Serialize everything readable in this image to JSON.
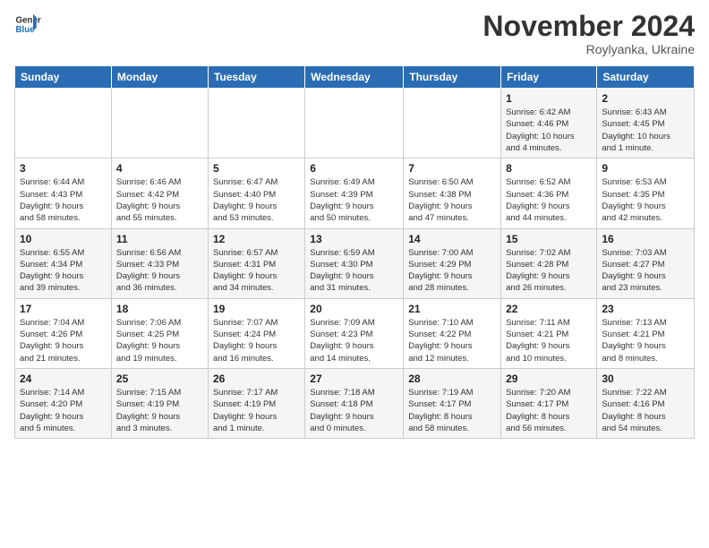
{
  "header": {
    "logo_line1": "General",
    "logo_line2": "Blue",
    "month_title": "November 2024",
    "subtitle": "Roylyanka, Ukraine"
  },
  "weekdays": [
    "Sunday",
    "Monday",
    "Tuesday",
    "Wednesday",
    "Thursday",
    "Friday",
    "Saturday"
  ],
  "weeks": [
    [
      {
        "day": "",
        "info": ""
      },
      {
        "day": "",
        "info": ""
      },
      {
        "day": "",
        "info": ""
      },
      {
        "day": "",
        "info": ""
      },
      {
        "day": "",
        "info": ""
      },
      {
        "day": "1",
        "info": "Sunrise: 6:42 AM\nSunset: 4:46 PM\nDaylight: 10 hours\nand 4 minutes."
      },
      {
        "day": "2",
        "info": "Sunrise: 6:43 AM\nSunset: 4:45 PM\nDaylight: 10 hours\nand 1 minute."
      }
    ],
    [
      {
        "day": "3",
        "info": "Sunrise: 6:44 AM\nSunset: 4:43 PM\nDaylight: 9 hours\nand 58 minutes."
      },
      {
        "day": "4",
        "info": "Sunrise: 6:46 AM\nSunset: 4:42 PM\nDaylight: 9 hours\nand 55 minutes."
      },
      {
        "day": "5",
        "info": "Sunrise: 6:47 AM\nSunset: 4:40 PM\nDaylight: 9 hours\nand 53 minutes."
      },
      {
        "day": "6",
        "info": "Sunrise: 6:49 AM\nSunset: 4:39 PM\nDaylight: 9 hours\nand 50 minutes."
      },
      {
        "day": "7",
        "info": "Sunrise: 6:50 AM\nSunset: 4:38 PM\nDaylight: 9 hours\nand 47 minutes."
      },
      {
        "day": "8",
        "info": "Sunrise: 6:52 AM\nSunset: 4:36 PM\nDaylight: 9 hours\nand 44 minutes."
      },
      {
        "day": "9",
        "info": "Sunrise: 6:53 AM\nSunset: 4:35 PM\nDaylight: 9 hours\nand 42 minutes."
      }
    ],
    [
      {
        "day": "10",
        "info": "Sunrise: 6:55 AM\nSunset: 4:34 PM\nDaylight: 9 hours\nand 39 minutes."
      },
      {
        "day": "11",
        "info": "Sunrise: 6:56 AM\nSunset: 4:33 PM\nDaylight: 9 hours\nand 36 minutes."
      },
      {
        "day": "12",
        "info": "Sunrise: 6:57 AM\nSunset: 4:31 PM\nDaylight: 9 hours\nand 34 minutes."
      },
      {
        "day": "13",
        "info": "Sunrise: 6:59 AM\nSunset: 4:30 PM\nDaylight: 9 hours\nand 31 minutes."
      },
      {
        "day": "14",
        "info": "Sunrise: 7:00 AM\nSunset: 4:29 PM\nDaylight: 9 hours\nand 28 minutes."
      },
      {
        "day": "15",
        "info": "Sunrise: 7:02 AM\nSunset: 4:28 PM\nDaylight: 9 hours\nand 26 minutes."
      },
      {
        "day": "16",
        "info": "Sunrise: 7:03 AM\nSunset: 4:27 PM\nDaylight: 9 hours\nand 23 minutes."
      }
    ],
    [
      {
        "day": "17",
        "info": "Sunrise: 7:04 AM\nSunset: 4:26 PM\nDaylight: 9 hours\nand 21 minutes."
      },
      {
        "day": "18",
        "info": "Sunrise: 7:06 AM\nSunset: 4:25 PM\nDaylight: 9 hours\nand 19 minutes."
      },
      {
        "day": "19",
        "info": "Sunrise: 7:07 AM\nSunset: 4:24 PM\nDaylight: 9 hours\nand 16 minutes."
      },
      {
        "day": "20",
        "info": "Sunrise: 7:09 AM\nSunset: 4:23 PM\nDaylight: 9 hours\nand 14 minutes."
      },
      {
        "day": "21",
        "info": "Sunrise: 7:10 AM\nSunset: 4:22 PM\nDaylight: 9 hours\nand 12 minutes."
      },
      {
        "day": "22",
        "info": "Sunrise: 7:11 AM\nSunset: 4:21 PM\nDaylight: 9 hours\nand 10 minutes."
      },
      {
        "day": "23",
        "info": "Sunrise: 7:13 AM\nSunset: 4:21 PM\nDaylight: 9 hours\nand 8 minutes."
      }
    ],
    [
      {
        "day": "24",
        "info": "Sunrise: 7:14 AM\nSunset: 4:20 PM\nDaylight: 9 hours\nand 5 minutes."
      },
      {
        "day": "25",
        "info": "Sunrise: 7:15 AM\nSunset: 4:19 PM\nDaylight: 9 hours\nand 3 minutes."
      },
      {
        "day": "26",
        "info": "Sunrise: 7:17 AM\nSunset: 4:19 PM\nDaylight: 9 hours\nand 1 minute."
      },
      {
        "day": "27",
        "info": "Sunrise: 7:18 AM\nSunset: 4:18 PM\nDaylight: 9 hours\nand 0 minutes."
      },
      {
        "day": "28",
        "info": "Sunrise: 7:19 AM\nSunset: 4:17 PM\nDaylight: 8 hours\nand 58 minutes."
      },
      {
        "day": "29",
        "info": "Sunrise: 7:20 AM\nSunset: 4:17 PM\nDaylight: 8 hours\nand 56 minutes."
      },
      {
        "day": "30",
        "info": "Sunrise: 7:22 AM\nSunset: 4:16 PM\nDaylight: 8 hours\nand 54 minutes."
      }
    ]
  ]
}
